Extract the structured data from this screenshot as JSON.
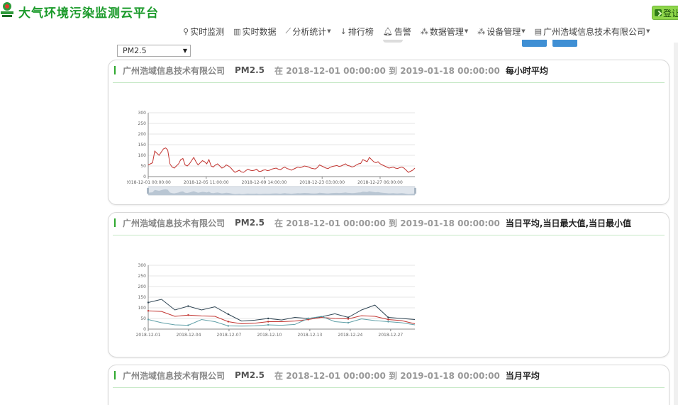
{
  "app": {
    "title": "大气环境污染监测云平台",
    "login_label": "登让"
  },
  "nav": {
    "items": [
      {
        "icon": "map-marker-icon",
        "label": "实时监测",
        "caret": false
      },
      {
        "icon": "bar-chart-icon",
        "label": "实时数据",
        "caret": false
      },
      {
        "icon": "line-chart-icon",
        "label": "分析统计",
        "caret": true
      },
      {
        "icon": "sort-icon",
        "label": "排行榜",
        "caret": false
      },
      {
        "icon": "bell-icon",
        "label": "告警",
        "caret": false
      },
      {
        "icon": "sitemap-icon",
        "label": "数据管理",
        "caret": true
      },
      {
        "icon": "sitemap-icon",
        "label": "设备管理",
        "caret": true
      },
      {
        "icon": "building-icon",
        "label": "广州浩域信息技术有限公司",
        "caret": true
      }
    ]
  },
  "controls": {
    "pollutant_select_value": "PM2.5"
  },
  "panels": [
    {
      "company": "广州浩域信息技术有限公司",
      "pollutant": "PM2.5",
      "range_prefix": "在",
      "start": "2018-12-01 00:00:00",
      "range_to": "到",
      "end": "2019-01-18 00:00:00",
      "statistic": "每小时平均"
    },
    {
      "company": "广州浩域信息技术有限公司",
      "pollutant": "PM2.5",
      "range_prefix": "在",
      "start": "2018-12-01 00:00:00",
      "range_to": "到",
      "end": "2019-01-18 00:00:00",
      "statistic": "当日平均,当日最大值,当日最小值"
    },
    {
      "company": "广州浩域信息技术有限公司",
      "pollutant": "PM2.5",
      "range_prefix": "在",
      "start": "2018-12-01 00:00:00",
      "range_to": "到",
      "end": "2019-01-18 00:00:00",
      "statistic": "当月平均"
    }
  ],
  "chart_data": [
    {
      "type": "line",
      "x_ticks": [
        "2018-12-01 00:00:00",
        "2018-12-05 11:00:00",
        "2018-12-09 14:00:00",
        "2018-12-23 03:00:00",
        "2018-12-27 06:00:00"
      ],
      "ylim": [
        0,
        300
      ],
      "y_ticks": [
        "0",
        "50",
        "100",
        "150",
        "200",
        "250",
        "300"
      ],
      "grid": true,
      "has_zoom_slider": true,
      "series": [
        {
          "color": "#c23531",
          "values": [
            55,
            60,
            65,
            120,
            110,
            100,
            115,
            130,
            135,
            125,
            60,
            45,
            40,
            50,
            60,
            80,
            85,
            55,
            50,
            60,
            75,
            90,
            70,
            55,
            65,
            75,
            70,
            60,
            80,
            50,
            45,
            55,
            60,
            50,
            40,
            45,
            55,
            50,
            42,
            30,
            20,
            25,
            30,
            22,
            20,
            28,
            35,
            30,
            28,
            30,
            35,
            25,
            25,
            30,
            32,
            28,
            30,
            35,
            38,
            40,
            35,
            32,
            40,
            45,
            38,
            35,
            30,
            35,
            40,
            45,
            42,
            45,
            50,
            48,
            45,
            40,
            38,
            36,
            42,
            55,
            50,
            45,
            40,
            38,
            44,
            48,
            50,
            52,
            48,
            50,
            55,
            60,
            52,
            50,
            45,
            48,
            55,
            60,
            62,
            80,
            75,
            70,
            90,
            80,
            70,
            65,
            70,
            60,
            55,
            50,
            45,
            40,
            42,
            45,
            40,
            38,
            42,
            45,
            40,
            30,
            20,
            25,
            30,
            40
          ]
        }
      ]
    },
    {
      "type": "line",
      "x_ticks": [
        "2018-12-01",
        "2018-12-04",
        "2018-12-07",
        "2018-12-10",
        "2018-12-13",
        "2018-12-24",
        "2018-12-27"
      ],
      "ylim": [
        0,
        300
      ],
      "y_ticks": [
        "0",
        "50",
        "100",
        "150",
        "200",
        "250",
        "300"
      ],
      "grid": true,
      "series": [
        {
          "color": "#2f4554",
          "values": [
            125,
            140,
            90,
            108,
            90,
            105,
            70,
            38,
            42,
            50,
            43,
            55,
            50,
            58,
            72,
            55,
            90,
            113,
            55,
            50,
            45
          ]
        },
        {
          "color": "#c23531",
          "values": [
            86,
            83,
            60,
            66,
            62,
            60,
            35,
            25,
            28,
            35,
            35,
            38,
            45,
            55,
            50,
            48,
            63,
            60,
            45,
            40,
            25
          ]
        },
        {
          "color": "#61a0a8",
          "values": [
            45,
            30,
            20,
            18,
            45,
            35,
            15,
            14,
            15,
            20,
            18,
            22,
            50,
            60,
            35,
            30,
            48,
            40,
            35,
            30,
            20
          ]
        }
      ]
    }
  ]
}
